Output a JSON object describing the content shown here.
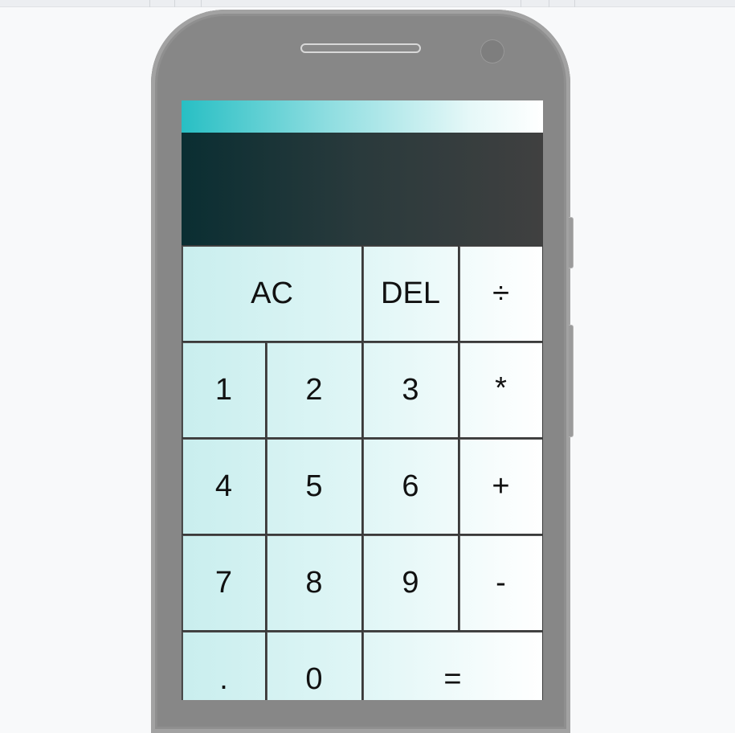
{
  "calculator": {
    "display": {
      "previous_operand": "",
      "current_operand": ""
    },
    "keys": {
      "all_clear": "AC",
      "delete": "DEL",
      "divide": "÷",
      "one": "1",
      "two": "2",
      "three": "3",
      "multiply": "*",
      "four": "4",
      "five": "5",
      "six": "6",
      "plus": "+",
      "seven": "7",
      "eight": "8",
      "nine": "9",
      "minus": "-",
      "decimal": ".",
      "zero": "0",
      "equals": "="
    }
  },
  "colors": {
    "accent": "#28bfc4",
    "display_dark": "#0a2e32",
    "display_gray": "#404040",
    "phone_body": "#878787"
  }
}
